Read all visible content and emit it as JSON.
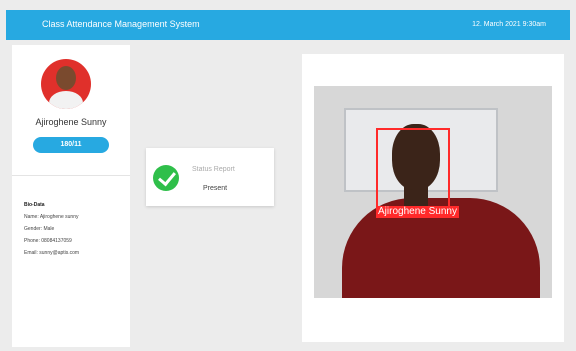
{
  "header": {
    "title": "Class Attendance Management System",
    "datetime": "12. March 2021 9:30am",
    "accent_color": "#27a9e1"
  },
  "profile": {
    "name": "Ajiroghene Sunny",
    "id_badge": "180/11",
    "bio_heading": "Bio-Data",
    "bio": [
      "Name:   Ajiroghene sunny",
      "Gender:  Male",
      "Phone:   08084137059",
      "Email: sunny@aptis.com"
    ]
  },
  "status": {
    "label": "Status Report",
    "value": "Present",
    "status_color": "#2fbf4a"
  },
  "camera": {
    "face_label": "Ajiroghene Sunny",
    "box_color": "#ff2a2a"
  }
}
